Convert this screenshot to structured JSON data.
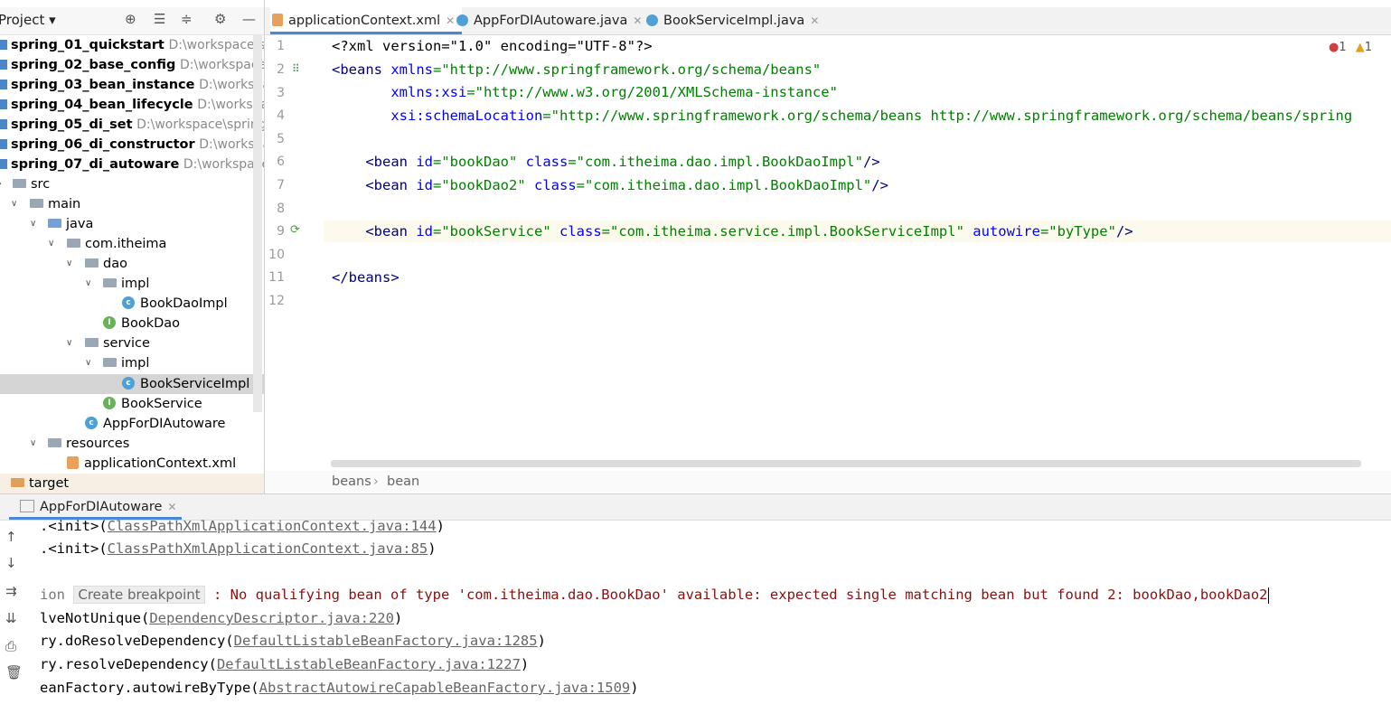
{
  "project": {
    "title": "Project",
    "modules": [
      {
        "name": "spring_01_quickstart",
        "path": "D:\\workspace\\spri"
      },
      {
        "name": "spring_02_base_config",
        "path": "D:\\workspace\\sp"
      },
      {
        "name": "spring_03_bean_instance",
        "path": "D:\\workspace\\"
      },
      {
        "name": "spring_04_bean_lifecycle",
        "path": "D:\\workspace\\"
      },
      {
        "name": "spring_05_di_set",
        "path": "D:\\workspace\\spring\\s"
      },
      {
        "name": "spring_06_di_constructor",
        "path": "D:\\workspace"
      },
      {
        "name": "spring_07_di_autoware",
        "path": "D:\\workspace\\sp"
      }
    ],
    "tree": {
      "src": "src",
      "main": "main",
      "java": "java",
      "pkg": "com.itheima",
      "dao": "dao",
      "dao_impl": "impl",
      "book_dao_impl": "BookDaoImpl",
      "book_dao": "BookDao",
      "service": "service",
      "service_impl": "impl",
      "book_service_impl": "BookServiceImpl",
      "book_service": "BookService",
      "app": "AppForDIAutoware",
      "resources": "resources",
      "app_context": "applicationContext.xml",
      "target": "target"
    }
  },
  "tabs": [
    {
      "label": "applicationContext.xml",
      "active": true
    },
    {
      "label": "AppForDIAutoware.java",
      "active": false
    },
    {
      "label": "BookServiceImpl.java",
      "active": false
    }
  ],
  "inspections": {
    "errors": "1",
    "warnings": "1"
  },
  "editor": {
    "line_numbers": [
      "1",
      "2",
      "3",
      "4",
      "5",
      "6",
      "7",
      "8",
      "9",
      "10",
      "11",
      "12"
    ],
    "lines": {
      "l1": "<?xml version=\"1.0\" encoding=\"UTF-8\"?>",
      "l2_tag": "<beans",
      "l2_attr": " xmlns",
      "l2_val": "=\"http://www.springframework.org/schema/beans\"",
      "l3_attr": "       xmlns:xsi",
      "l3_val": "=\"http://www.w3.org/2001/XMLSchema-instance\"",
      "l4_attr": "       xsi:schemaLocation",
      "l4_val": "=\"http://www.springframework.org/schema/beans http://www.springframework.org/schema/beans/spring",
      "l6_tag": "    <bean",
      "l6_a1": " id",
      "l6_v1": "=\"bookDao\"",
      "l6_a2": " class",
      "l6_v2": "=\"com.itheima.dao.impl.BookDaoImpl\"",
      "l6_end": "/>",
      "l7_tag": "    <bean",
      "l7_a1": " id",
      "l7_v1": "=\"bookDao2\"",
      "l7_a2": " class",
      "l7_v2": "=\"com.itheima.dao.impl.BookDaoImpl\"",
      "l7_end": "/>",
      "l9_tag": "    <bean",
      "l9_a1": " id",
      "l9_v1": "=\"bookService\"",
      "l9_a2": " class",
      "l9_v2": "=\"com.itheima.service.impl.BookServiceImpl\"",
      "l9_a3": " autowire",
      "l9_v3": "=\"byType\"",
      "l9_end": "/>",
      "l11": "</beans>"
    }
  },
  "breadcrumb": {
    "first": "beans",
    "sep": "›",
    "second": "bean"
  },
  "run": {
    "tab_label": "AppForDIAutoware",
    "console": {
      "c1_pre": ".<init>(",
      "c1_link": "ClassPathXmlApplicationContext.java:144",
      "c1_post": ")",
      "c2_pre": ".<init>(",
      "c2_link": "ClassPathXmlApplicationContext.java:85",
      "c2_post": ")",
      "c3_prefix": "ion",
      "c3_hint": "Create breakpoint",
      "c3_msg": " : No qualifying bean of type 'com.itheima.dao.BookDao' available: expected single matching bean but found 2: bookDao,bookDao2",
      "c4_pre": "lveNotUnique(",
      "c4_link": "DependencyDescriptor.java:220",
      "c4_post": ")",
      "c5_pre": "ry.doResolveDependency(",
      "c5_link": "DefaultListableBeanFactory.java:1285",
      "c5_post": ")",
      "c6_pre": "ry.resolveDependency(",
      "c6_link": "DefaultListableBeanFactory.java:1227",
      "c6_post": ")",
      "c7_pre": "eanFactory.autowireByType(",
      "c7_link": "AbstractAutowireCapableBeanFactory.java:1509",
      "c7_post": ")"
    }
  }
}
